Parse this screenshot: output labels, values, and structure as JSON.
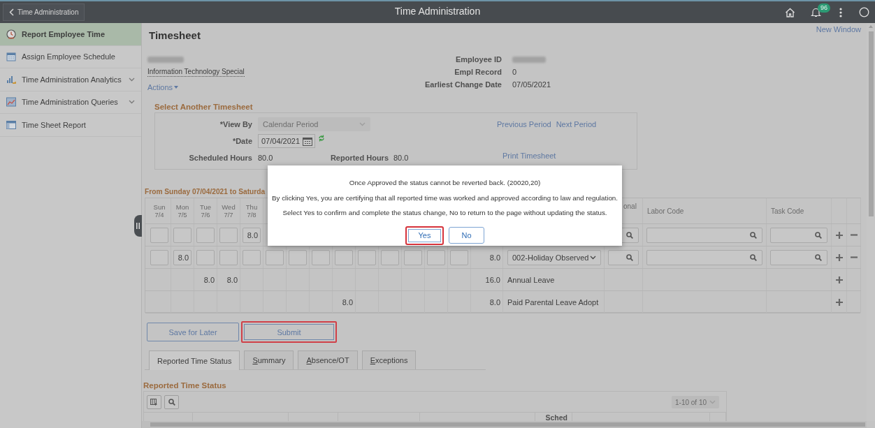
{
  "topbar": {
    "back_label": "Time Administration",
    "title": "Time Administration",
    "notification_count": "96"
  },
  "sidebar": {
    "items": [
      {
        "label": "Report Employee Time",
        "kind": "page",
        "selected": true
      },
      {
        "label": "Assign Employee Schedule",
        "kind": "page",
        "selected": false
      },
      {
        "label": "Time Administration Analytics",
        "kind": "menu",
        "selected": false
      },
      {
        "label": "Time Administration Queries",
        "kind": "menu",
        "selected": false
      },
      {
        "label": "Time Sheet Report",
        "kind": "page",
        "selected": false
      }
    ]
  },
  "new_window_link": "New Window",
  "header": {
    "title": "Timesheet",
    "employee_name_redacted": true,
    "job_title": "Information Technology Special",
    "actions_menu": "Actions",
    "fields": [
      {
        "label": "Employee ID",
        "redacted": true
      },
      {
        "label": "Empl Record",
        "value": "0",
        "redacted": false
      },
      {
        "label": "Earliest Change Date",
        "value": "07/05/2021",
        "redacted": false
      }
    ]
  },
  "select_timesheet": {
    "title": "Select Another Timesheet",
    "view_by": {
      "label": "*View By",
      "value": "Calendar Period",
      "disabled": true
    },
    "date": {
      "label": "*Date",
      "value": "07/04/2021"
    },
    "scheduled_hours": {
      "label": "Scheduled Hours",
      "value": "80.0"
    },
    "reported_hours": {
      "label": "Reported Hours",
      "value": "80.0"
    },
    "period_links": [
      "Previous Period",
      "Next Period"
    ],
    "print_link": "Print Timesheet"
  },
  "grid": {
    "title": "From Sunday 07/04/2021 to Saturda",
    "day_columns": [
      {
        "day": "Sun",
        "date": "7/4"
      },
      {
        "day": "Mon",
        "date": "7/5"
      },
      {
        "day": "Tue",
        "date": "7/6"
      },
      {
        "day": "Wed",
        "date": "7/7"
      },
      {
        "day": "Thu",
        "date": "7/8"
      }
    ],
    "other_columns": [
      "onal",
      "Labor Code",
      "Task Code"
    ],
    "rows": [
      {
        "kind": "entry",
        "days": [
          {
            "kind": "input"
          },
          {
            "kind": "input"
          },
          {
            "kind": "input"
          },
          {
            "kind": "input"
          },
          {
            "kind": "input",
            "hours": "8.0"
          }
        ],
        "removable": true
      },
      {
        "kind": "entry",
        "days": [
          {
            "kind": "input"
          },
          {
            "kind": "input",
            "hours": "8.0"
          },
          {
            "kind": "input"
          },
          {
            "kind": "input"
          },
          {
            "kind": "input"
          },
          {
            "kind": "input"
          },
          {
            "kind": "input"
          },
          {
            "kind": "input"
          },
          {
            "kind": "input"
          },
          {
            "kind": "input"
          },
          {
            "kind": "input"
          },
          {
            "kind": "input"
          },
          {
            "kind": "input"
          },
          {
            "kind": "input"
          }
        ],
        "total": "8.0",
        "trc": "002-Holiday Observed",
        "removable": true
      },
      {
        "kind": "reported",
        "days": [
          {
            "kind": "blank"
          },
          {
            "kind": "blank"
          },
          {
            "kind": "text",
            "hours": "8.0"
          },
          {
            "kind": "text",
            "hours": "8.0"
          },
          {
            "kind": "blank"
          },
          {
            "kind": "blank"
          },
          {
            "kind": "blank"
          },
          {
            "kind": "blank"
          },
          {
            "kind": "blank"
          },
          {
            "kind": "blank"
          },
          {
            "kind": "blank"
          },
          {
            "kind": "blank"
          },
          {
            "kind": "blank"
          },
          {
            "kind": "blank"
          }
        ],
        "total": "16.0",
        "trc": "Annual Leave",
        "removable": false
      },
      {
        "kind": "reported",
        "days": [
          {
            "kind": "blank"
          },
          {
            "kind": "blank"
          },
          {
            "kind": "blank"
          },
          {
            "kind": "blank"
          },
          {
            "kind": "blank"
          },
          {
            "kind": "blank"
          },
          {
            "kind": "blank"
          },
          {
            "kind": "blank"
          },
          {
            "kind": "text",
            "hours": "8.0"
          },
          {
            "kind": "blank"
          },
          {
            "kind": "blank"
          },
          {
            "kind": "blank"
          },
          {
            "kind": "blank"
          },
          {
            "kind": "blank"
          }
        ],
        "total": "8.0",
        "trc": "Paid Parental Leave Adopt",
        "removable": false
      }
    ]
  },
  "buttons": [
    {
      "label": "Save for Later",
      "highlighted": false
    },
    {
      "label": "Submit",
      "highlighted": true
    }
  ],
  "tabs": [
    {
      "label": "Reported Time Status",
      "selected": true,
      "mnemonic": false
    },
    {
      "label": "Summary",
      "selected": false,
      "mnemonic": true
    },
    {
      "label": "Absence/OT",
      "selected": false,
      "mnemonic": true
    },
    {
      "label": "Exceptions",
      "selected": false,
      "mnemonic": true
    }
  ],
  "status_table": {
    "title": "Reported Time Status",
    "pager": "1-10 of 10",
    "columns": [
      "Sched"
    ]
  },
  "dialog": {
    "lines": [
      "Once Approved the status cannot be reverted back. (20020,20)",
      "By clicking Yes, you are certifying that all reported time was worked and approved according to law and regulation.",
      "Select Yes to confirm and complete the status change, No to return to the page without updating the status."
    ],
    "buttons": [
      {
        "label": "Yes",
        "highlighted": true
      },
      {
        "label": "No",
        "highlighted": false
      }
    ]
  }
}
